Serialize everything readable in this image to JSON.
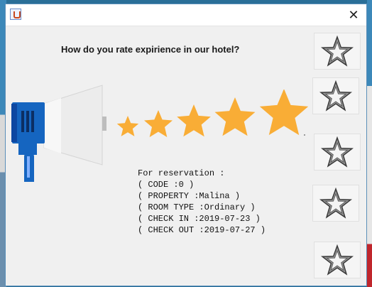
{
  "window": {
    "title": "",
    "close_glyph": "✕",
    "icon": "java-icon"
  },
  "question": "How do you rate expirience in our hotel?",
  "reservation": {
    "header": "For reservation :",
    "code": "( CODE :0 )",
    "property": "( PROPERTY :Malina )",
    "room_type": "( ROOM TYPE :Ordinary )",
    "check_in": "( CHECK IN :2019-07-23 )",
    "check_out": "( CHECK OUT :2019-07-27 )"
  },
  "rating_buttons": [
    {
      "icon": "star-outline-icon",
      "value": 1
    },
    {
      "icon": "star-outline-icon",
      "value": 2
    },
    {
      "icon": "star-outline-icon",
      "value": 3
    },
    {
      "icon": "star-outline-icon",
      "value": 4
    },
    {
      "icon": "star-outline-icon",
      "value": 5
    }
  ],
  "colors": {
    "star_fill": "#f9ad36",
    "megaphone_blue": "#1565c0",
    "megaphone_horn": "#ececec"
  }
}
